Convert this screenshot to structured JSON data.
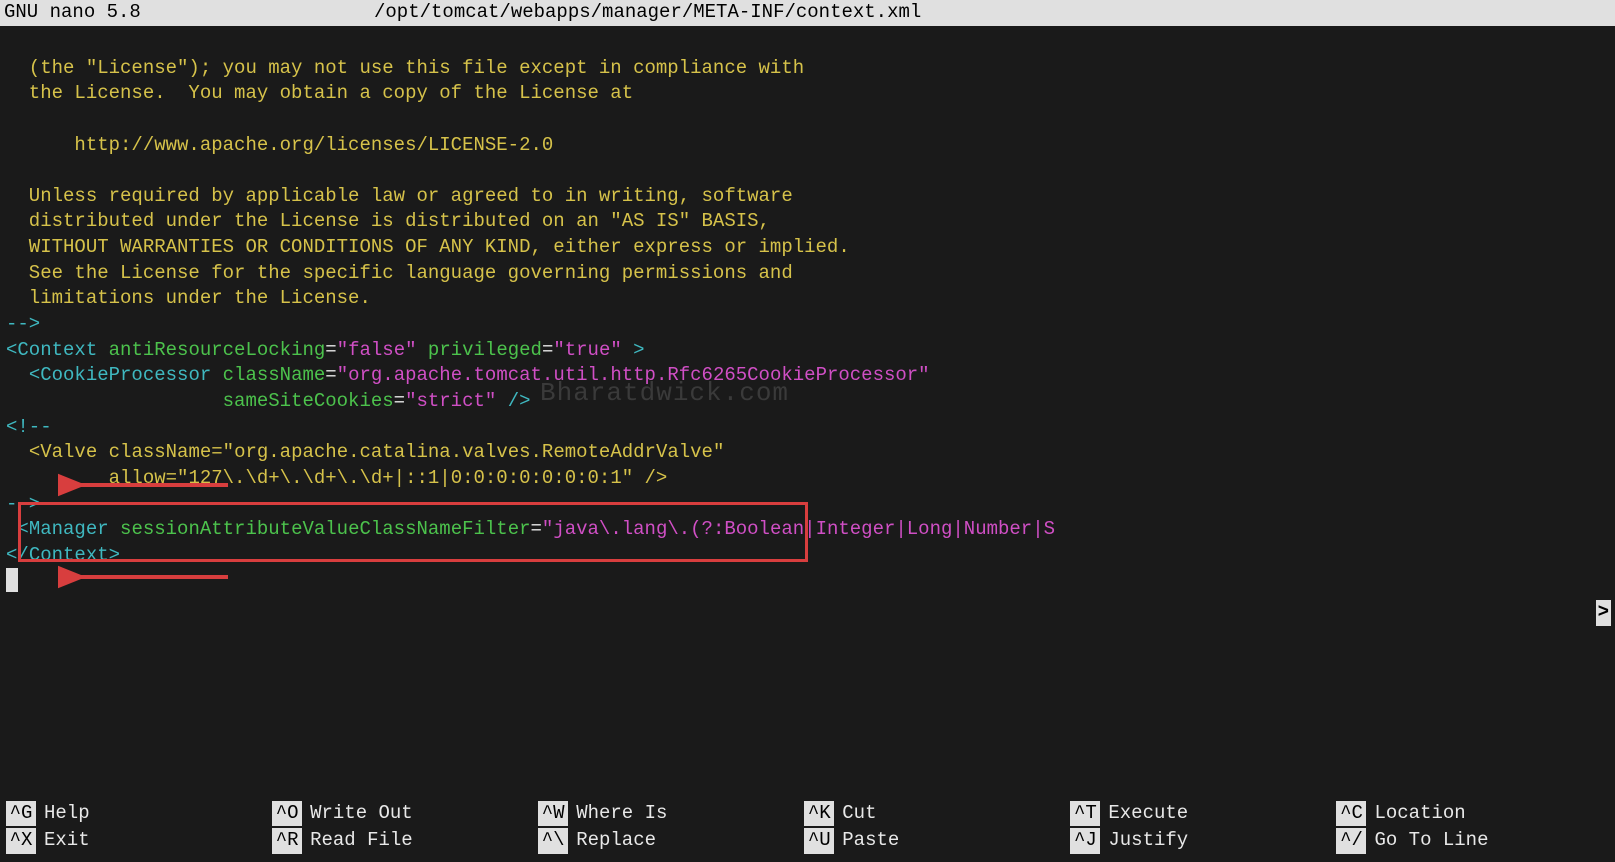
{
  "titlebar": {
    "app": "  GNU nano 5.8",
    "file": "/opt/tomcat/webapps/manager/META-INF/context.xml"
  },
  "lines": {
    "l1": "  (the \"License\"); you may not use this file except in compliance with",
    "l2": "  the License.  You may obtain a copy of the License at",
    "l3": "      http://www.apache.org/licenses/LICENSE-2.0",
    "l4": "  Unless required by applicable law or agreed to in writing, software",
    "l5": "  distributed under the License is distributed on an \"AS IS\" BASIS,",
    "l6": "  WITHOUT WARRANTIES OR CONDITIONS OF ANY KIND, either express or implied.",
    "l7": "  See the License for the specific language governing permissions and",
    "l8": "  limitations under the License.",
    "comment_end1": "-->",
    "ctx_open": "<",
    "ctx_tag": "Context",
    "ctx_attr1": " antiResourceLocking",
    "ctx_eq1": "=",
    "ctx_val1": "\"false\"",
    "ctx_attr2": " privileged",
    "ctx_eq2": "=",
    "ctx_val2": "\"true\"",
    "ctx_close": " >",
    "cp_indent": "  ",
    "cp_open": "<",
    "cp_tag": "CookieProcessor",
    "cp_attr1": " className",
    "cp_eq1": "=",
    "cp_val1": "\"org.apache.tomcat.util.http.Rfc6265CookieProcessor\"",
    "cp_indent2": "                  ",
    "cp_attr2": " sameSiteCookies",
    "cp_eq2": "=",
    "cp_val2": "\"strict\"",
    "cp_close": " />",
    "comment_start": "<!--",
    "valve_indent": "  ",
    "valve_open": "<",
    "valve_tag": "Valve",
    "valve_attr1": " className",
    "valve_eq1": "=",
    "valve_val1": "\"org.apache.catalina.valves.RemoteAddrValve\"",
    "valve_indent2": "        ",
    "valve_attr2": " allow",
    "valve_eq2": "=",
    "valve_val2": "\"127\\.\\d+\\.\\d+\\.\\d+|::1|0:0:0:0:0:0:0:1\"",
    "valve_close": " />",
    "comment_end2": "-->",
    "mgr_indent": " ",
    "mgr_open": "<",
    "mgr_tag": "Manager",
    "mgr_attr1": " sessionAttributeValueClassNameFilter",
    "mgr_eq1": "=",
    "mgr_val1": "\"java\\.lang\\.(?:Boolean|Integer|Long|Number|S",
    "ctx_end_open": "</",
    "ctx_end_tag": "Context",
    "ctx_end_close": ">",
    "scroll_ind": ">"
  },
  "watermark": "Bharatdwick.com",
  "footer": {
    "items": [
      {
        "key": "^G",
        "label": "Help"
      },
      {
        "key": "^O",
        "label": "Write Out"
      },
      {
        "key": "^W",
        "label": "Where Is"
      },
      {
        "key": "^K",
        "label": "Cut"
      },
      {
        "key": "^T",
        "label": "Execute"
      },
      {
        "key": "^C",
        "label": "Location"
      },
      {
        "key": "^X",
        "label": "Exit"
      },
      {
        "key": "^R",
        "label": "Read File"
      },
      {
        "key": "^\\",
        "label": "Replace"
      },
      {
        "key": "^U",
        "label": "Paste"
      },
      {
        "key": "^J",
        "label": "Justify"
      },
      {
        "key": "^/",
        "label": "Go To Line"
      }
    ]
  }
}
